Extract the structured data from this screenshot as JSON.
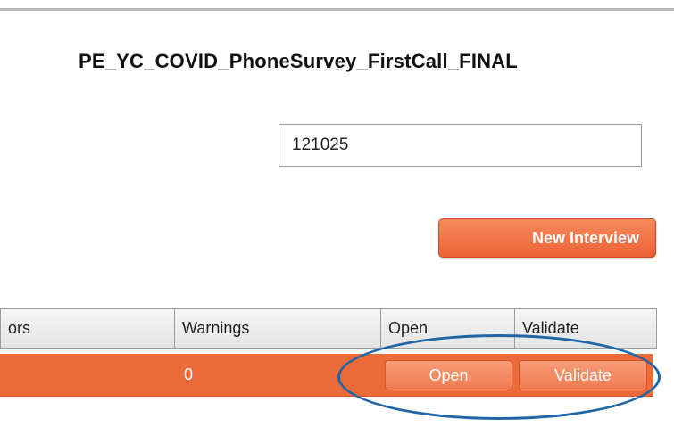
{
  "survey": {
    "title": "PE_YC_COVID_PhoneSurvey_FirstCall_FINAL"
  },
  "id_field": {
    "value": "121025"
  },
  "actions": {
    "new_interview_label": "New Interview"
  },
  "grid": {
    "headers": [
      "ors",
      "Warnings",
      "Open",
      "Validate"
    ],
    "rows": [
      {
        "warnings": "0",
        "open_label": "Open",
        "validate_label": "Validate"
      }
    ]
  },
  "colors": {
    "accent_orange": "#ed6a3a",
    "highlight_blue": "#1f66a8"
  }
}
